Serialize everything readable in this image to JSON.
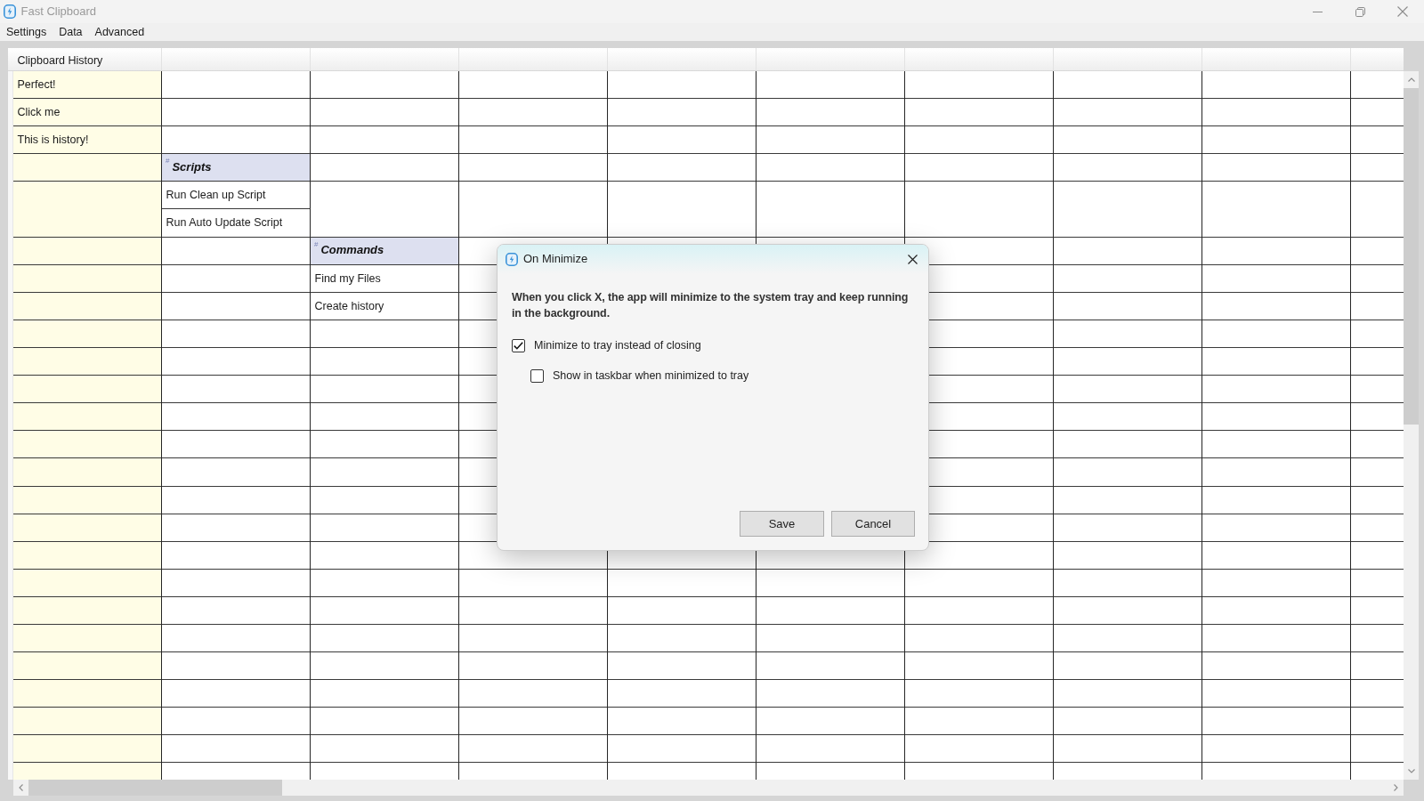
{
  "window": {
    "title": "Fast Clipboard"
  },
  "menu": [
    "Settings",
    "Data",
    "Advanced"
  ],
  "grid": {
    "history_header": "Clipboard History",
    "history": [
      "Perfect!",
      "Click me",
      "This is history!"
    ],
    "groups": [
      {
        "mark": "#",
        "title": "Scripts",
        "items": [
          "Run Clean up Script",
          "Run Auto Update Script"
        ]
      },
      {
        "mark": "#",
        "title": "Commands",
        "items": [
          "Find my Files",
          "Create history"
        ]
      }
    ]
  },
  "dialog": {
    "title": "On Minimize",
    "message": "When you click X, the app will minimize to the system tray and keep running in the background.",
    "options": [
      {
        "label": "Minimize to tray instead of closing",
        "checked": true,
        "children": [
          {
            "label": "Show in taskbar when minimized to tray",
            "checked": false
          }
        ]
      }
    ],
    "buttons": [
      "Save",
      "Cancel"
    ]
  }
}
